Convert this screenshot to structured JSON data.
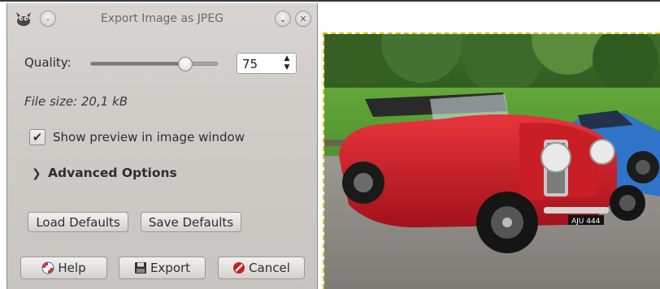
{
  "dialog": {
    "title": "Export Image as JPEG",
    "quality_label": "Quality:",
    "quality_value": "75",
    "quality_fraction": 0.75,
    "file_size": "File size: 20,1 kB",
    "preview_checkbox_label": "Show preview in image window",
    "preview_checked": true,
    "advanced_label": "Advanced Options",
    "load_defaults_label": "Load Defaults",
    "save_defaults_label": "Save Defaults",
    "help_label": "Help",
    "export_label": "Export",
    "cancel_label": "Cancel"
  },
  "icons": {
    "app": "gimp-wilber-icon",
    "minimize": "minimize-icon",
    "shade": "chevron-down-icon",
    "close": "close-icon",
    "help": "lifebuoy-icon",
    "export": "floppy-disk-icon",
    "cancel": "cancel-icon",
    "advanced": "chevron-right-icon"
  },
  "preview": {
    "subject": "red vintage convertible car",
    "license_plate": "AJU 444"
  }
}
